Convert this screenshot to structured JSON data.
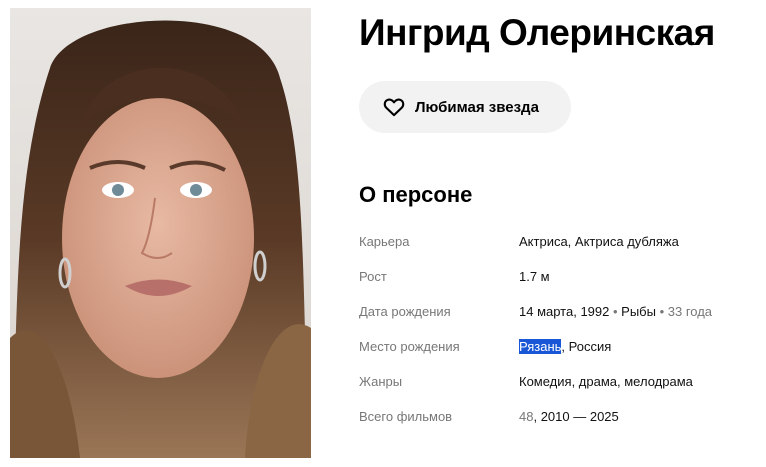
{
  "person": {
    "name": "Ингрид Олеринская",
    "favorite_label": "Любимая звезда"
  },
  "about": {
    "title": "О персоне",
    "career": {
      "label": "Карьера",
      "value": "Актриса, Актриса дубляжа"
    },
    "height": {
      "label": "Рост",
      "value": "1.7 м"
    },
    "birth_date": {
      "label": "Дата рождения",
      "date": "14 марта, 1992",
      "sep1": " • ",
      "zodiac": "Рыбы",
      "sep2": " • ",
      "age": "33 года"
    },
    "birth_place": {
      "label": "Место рождения",
      "city": "Рязань",
      "rest": ", Россия"
    },
    "genres": {
      "label": "Жанры",
      "value": "Комедия, драма, мелодрама"
    },
    "films": {
      "label": "Всего фильмов",
      "count": "48",
      "years": ", 2010 — 2025"
    }
  },
  "colors": {
    "accent_selection": "#1a57d6",
    "button_bg": "#f2f2f2",
    "muted_text": "#777777"
  },
  "icons": {
    "favorite": "heart-outline-icon"
  }
}
